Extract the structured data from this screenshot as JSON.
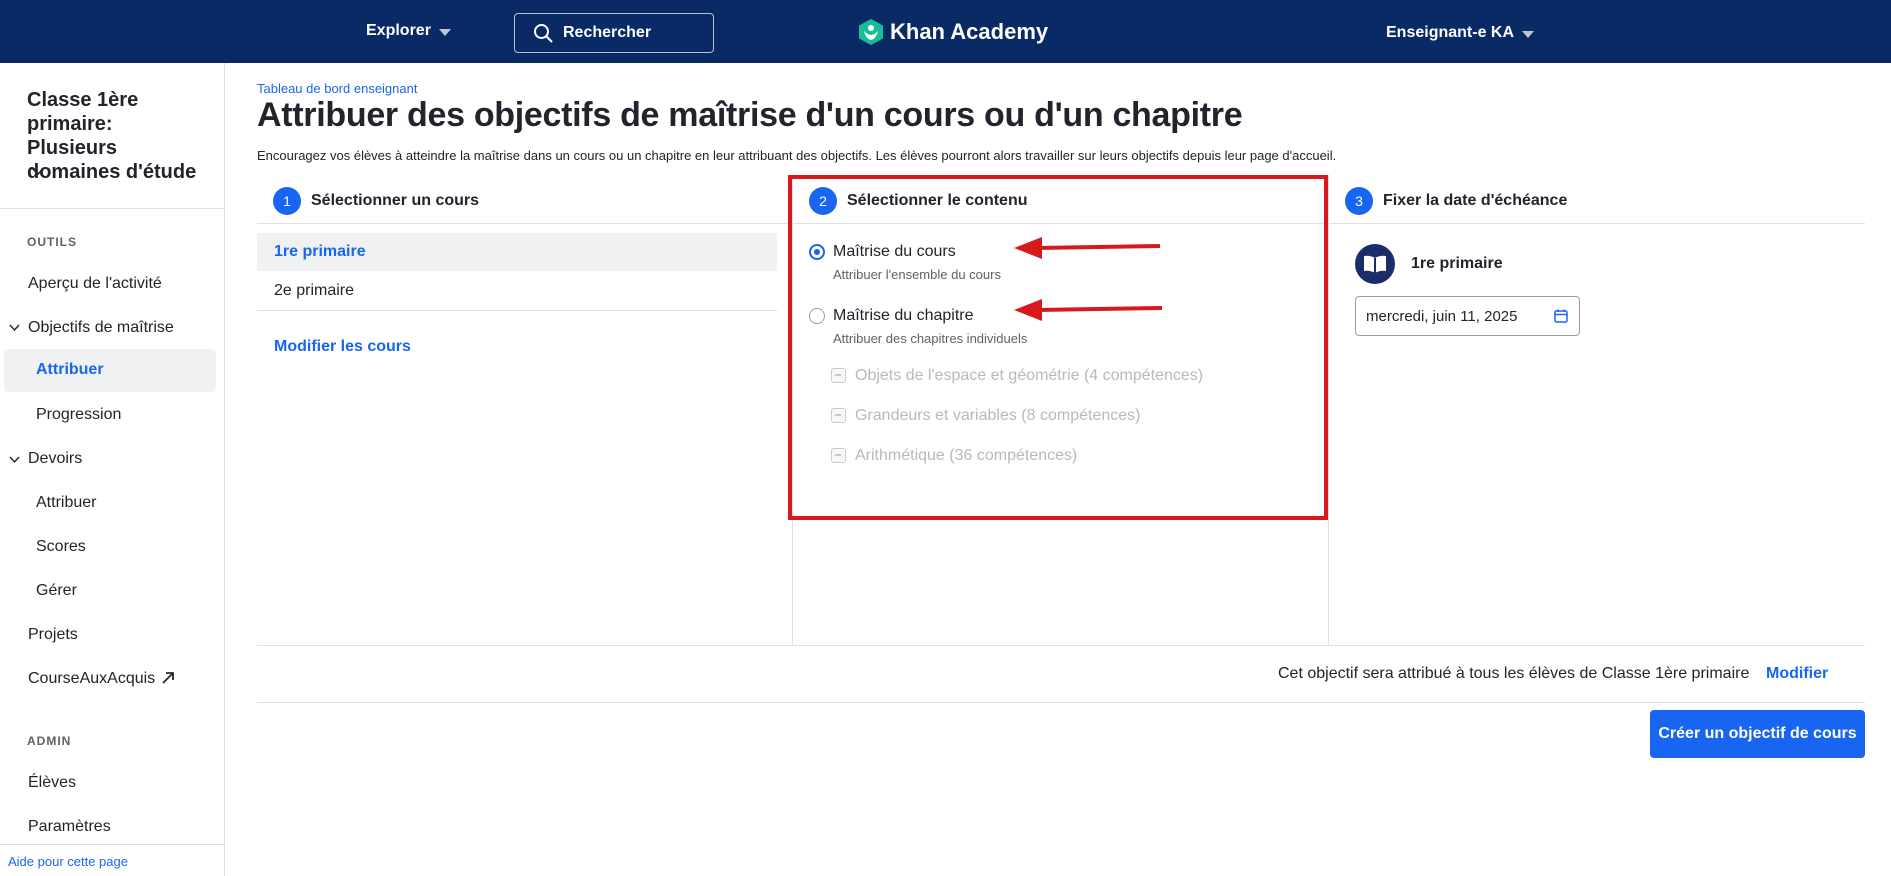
{
  "nav": {
    "explorer_label": "Explorer",
    "search_label": "Rechercher",
    "logo_text": "Khan Academy",
    "user_label": "Enseignant-e KA"
  },
  "sidebar": {
    "class_title": "Classe 1ère primaire: Plusieurs domaines d'étude",
    "tools_label": "OUTILS",
    "items": [
      {
        "label": "Aperçu de l'activité"
      },
      {
        "label": "Objectifs de maîtrise"
      },
      {
        "label": "Attribuer"
      },
      {
        "label": "Progression"
      },
      {
        "label": "Devoirs"
      },
      {
        "label": "Attribuer"
      },
      {
        "label": "Scores"
      },
      {
        "label": "Gérer"
      },
      {
        "label": "Projets"
      },
      {
        "label": "CourseAuxAcquis"
      }
    ],
    "admin_label": "ADMIN",
    "admin_items": [
      {
        "label": "Élèves"
      },
      {
        "label": "Paramètres"
      }
    ],
    "help_link": "Aide pour cette page"
  },
  "main": {
    "breadcrumb": "Tableau de bord enseignant",
    "title": "Attribuer des objectifs de maîtrise d'un cours ou d'un chapitre",
    "description": "Encouragez vos élèves à atteindre la maîtrise dans un cours ou un chapitre en leur attribuant des objectifs. Les élèves pourront alors travailler sur leurs objectifs depuis leur page d'accueil.",
    "steps": [
      {
        "number": "1",
        "title": "Sélectionner un cours"
      },
      {
        "number": "2",
        "title": "Sélectionner le contenu"
      },
      {
        "number": "3",
        "title": "Fixer la date d'échéance"
      }
    ],
    "courses": [
      "1re primaire",
      "2e primaire"
    ],
    "modify_courses": "Modifier les cours",
    "options": [
      {
        "label": "Maîtrise du cours",
        "sub": "Attribuer l'ensemble du cours",
        "checked": true
      },
      {
        "label": "Maîtrise du chapitre",
        "sub": "Attribuer des chapitres individuels",
        "checked": false
      }
    ],
    "chapters": [
      "Objets de l'espace et géométrie (4 compétences)",
      "Grandeurs et variables (8 compétences)",
      "Arithmétique (36 compétences)"
    ],
    "due": {
      "course_name": "1re primaire",
      "date_value": "mercredi, juin 11, 2025"
    },
    "footer_note": "Cet objectif sera attribué à tous les élèves de Classe 1ère primaire",
    "modify_link": "Modifier",
    "create_button": "Créer un objectif de cours"
  },
  "colors": {
    "nav_bg": "#0a2a66",
    "accent": "#1865f2",
    "annotation": "#d7191c"
  }
}
